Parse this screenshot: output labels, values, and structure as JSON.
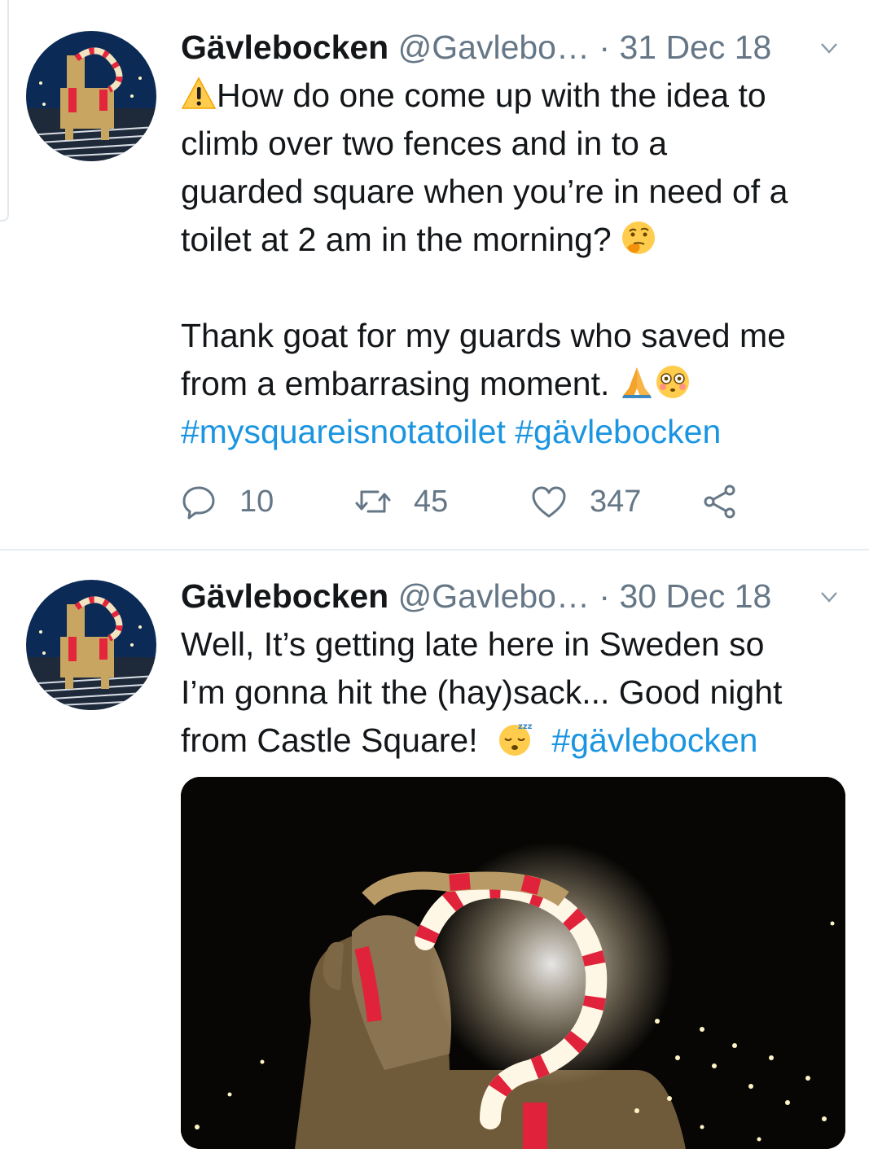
{
  "tweets": [
    {
      "display_name": "Gävlebocken",
      "handle": "@Gavlebo…",
      "separator": "·",
      "date": "31 Dec 18",
      "line1": "How do one come up with the idea to",
      "line2": "climb over two fences and in to a",
      "line3": "guarded square when you’re in need of a",
      "line4": "toilet at 2 am in the morning?",
      "line5": "Thank goat for my guards who saved me",
      "line6": "from a embarrasing moment.",
      "hashtags": "#mysquareisnotatoilet #gävlebocken",
      "replies": "10",
      "retweets": "45",
      "likes": "347"
    },
    {
      "display_name": "Gävlebocken",
      "handle": "@Gavlebo…",
      "separator": "·",
      "date": "30 Dec 18",
      "line1": "Well, It’s getting late here in Sweden so",
      "line2": "I’m gonna hit the (hay)sack... Good night",
      "line3": "from Castle Square!",
      "hashtag": "#gävlebocken"
    }
  ],
  "icons": [
    "warning-icon",
    "thinking-face-icon",
    "folded-hands-icon",
    "flushed-face-icon",
    "sleeping-face-icon",
    "reply-icon",
    "retweet-icon",
    "like-icon",
    "share-icon",
    "chevron-down-icon"
  ],
  "colors": {
    "hashtag": "#1b95e0",
    "muted": "#657786",
    "text": "#14171a"
  }
}
